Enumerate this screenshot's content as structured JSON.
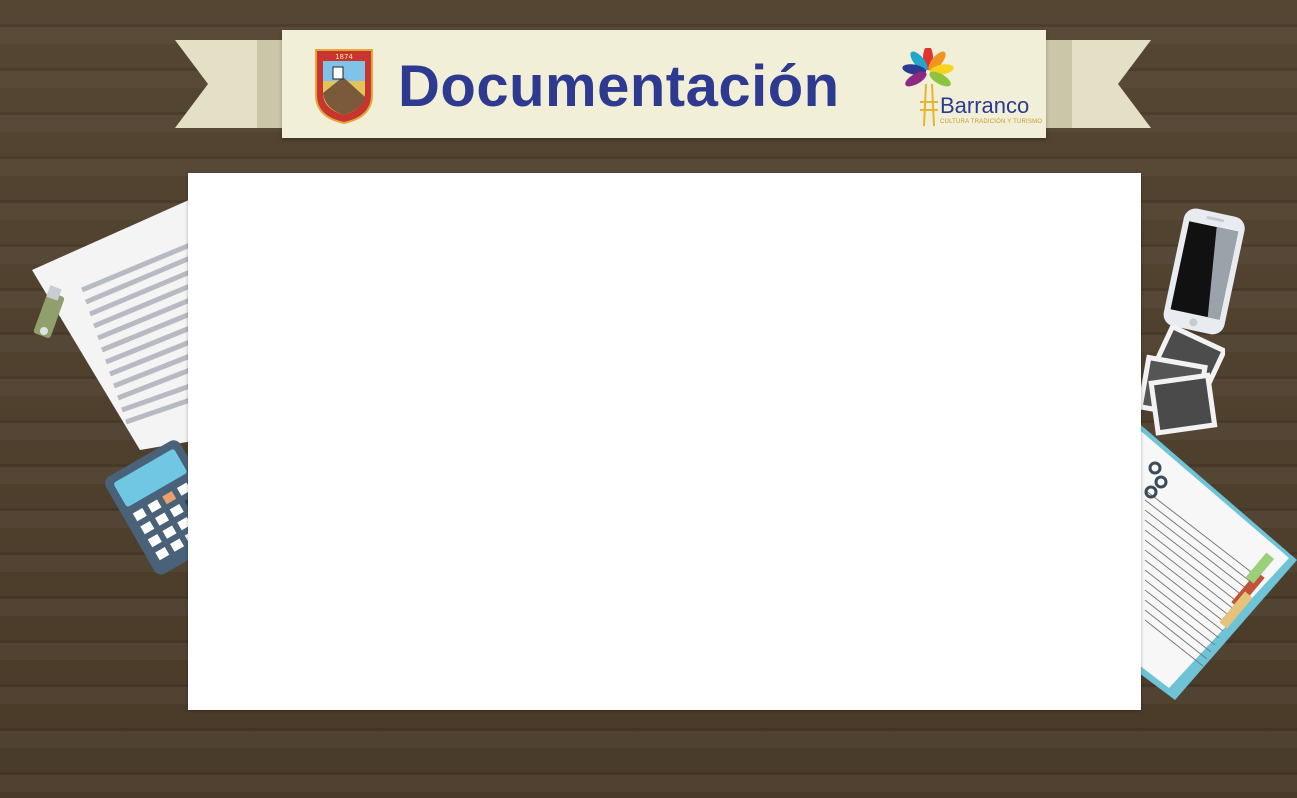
{
  "banner": {
    "title": "Documentación",
    "colors": {
      "title": "#2e3a8f",
      "banner_bg": "#f1efd8"
    }
  },
  "shield": {
    "year": "1874",
    "icon": "coat-of-arms-icon"
  },
  "brand": {
    "name": "Barranco",
    "tagline": "CULTURA TRADICIÓN Y TURISMO",
    "icon": "barranco-logo-icon"
  },
  "desk_items": [
    "document-icon",
    "usb-drive-icon",
    "calculator-icon",
    "smartphone-icon",
    "photos-icon",
    "notebook-icon"
  ],
  "board": {
    "color": "#ffffff"
  }
}
